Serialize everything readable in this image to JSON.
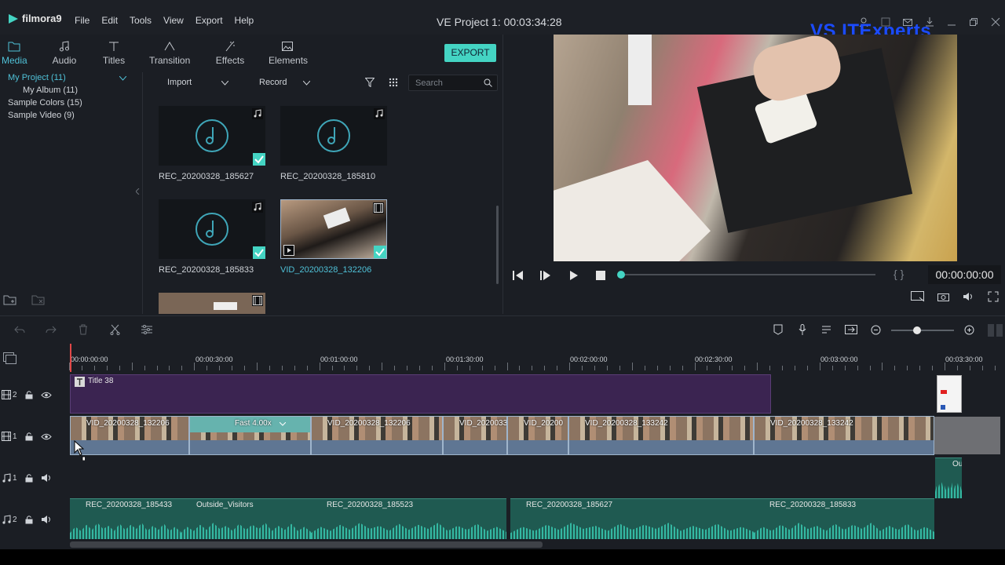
{
  "app": {
    "name": "filmora9",
    "project_title": "VE Project 1:  00:03:34:28",
    "watermark": "VS ITExperts"
  },
  "menu": [
    "File",
    "Edit",
    "Tools",
    "View",
    "Export",
    "Help"
  ],
  "tabs": [
    {
      "label": "Media",
      "active": true
    },
    {
      "label": "Audio"
    },
    {
      "label": "Titles"
    },
    {
      "label": "Transition"
    },
    {
      "label": "Effects"
    },
    {
      "label": "Elements"
    }
  ],
  "export_label": "EXPORT",
  "sidebar": {
    "items": [
      {
        "label": "My Project (11)"
      },
      {
        "label": "My Album (11)"
      },
      {
        "label": "Sample Colors (15)"
      },
      {
        "label": "Sample Video (9)"
      }
    ]
  },
  "library": {
    "import_label": "Import",
    "record_label": "Record",
    "search_placeholder": "Search",
    "items": [
      {
        "label": "REC_20200328_185627",
        "kind": "audio",
        "checked": true
      },
      {
        "label": "REC_20200328_185810",
        "kind": "audio",
        "checked": false
      },
      {
        "label": "REC_20200328_185833",
        "kind": "audio",
        "checked": true
      },
      {
        "label": "VID_20200328_132206",
        "kind": "video",
        "checked": true,
        "selected": true
      }
    ]
  },
  "preview": {
    "timecode": "00:00:00:00",
    "progress": 0
  },
  "timeline": {
    "ruler": [
      "00:00:00:00",
      "00:00:30:00",
      "00:01:00:00",
      "00:01:30:00",
      "00:02:00:00",
      "00:02:30:00",
      "00:03:00:00",
      "00:03:30:00"
    ],
    "tracks": [
      {
        "label": "2",
        "kind": "video"
      },
      {
        "label": "1",
        "kind": "video"
      },
      {
        "label": "1",
        "kind": "audio"
      },
      {
        "label": "2",
        "kind": "audio"
      }
    ],
    "title_clip": "Title 38",
    "video_clips": [
      "VID_20200328_132206",
      "Fast 4.00x",
      "VID_20200328_132206",
      "VID_2020033",
      "VID_20200",
      "VID_20200328_133242",
      "VID_20200328_133242"
    ],
    "audio_clips": [
      "REC_20200328_185433",
      "Outside_Visitors",
      "REC_20200328_185523",
      "REC_20200328_185627",
      "REC_20200328_185833"
    ],
    "audio1_clip": "Ou"
  },
  "colors": {
    "accent": "#44d4c3",
    "title_clip": "#3b2451",
    "video_clip": "#5f7693",
    "audio_clip": "#1f5a51",
    "playhead": "#e04848"
  }
}
